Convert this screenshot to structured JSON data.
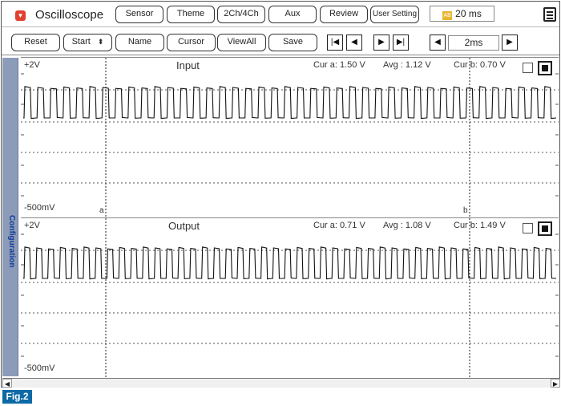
{
  "app": {
    "title": "Oscilloscope"
  },
  "toolbar_top": {
    "sensor": "Sensor",
    "theme": "Theme",
    "channels": "2Ch/4Ch",
    "aux": "Aux",
    "review": "Review",
    "user_setting": "User Setting",
    "time_display": "20 ms"
  },
  "toolbar_bottom": {
    "reset": "Reset",
    "start": "Start",
    "name": "Name",
    "cursor": "Cursor",
    "viewall": "ViewAll",
    "save": "Save",
    "time_div": "2ms"
  },
  "side_tab": {
    "label": "Configuration"
  },
  "channels": [
    {
      "title": "Input",
      "scale_top": "+2V",
      "scale_bottom": "-500mV",
      "cur_a": "Cur a: 1.50 V",
      "avg": "Avg  : 1.12 V",
      "cur_b": "Cur b: 0.70 V",
      "cursor_a_label": "a",
      "cursor_b_label": "b",
      "cycles": 41
    },
    {
      "title": "Output",
      "scale_top": "+2V",
      "scale_bottom": "-500mV",
      "cur_a": "Cur a: 0.71 V",
      "avg": "Avg  : 1.08 V",
      "cur_b": "Cur b: 1.49 V",
      "cycles": 45
    }
  ],
  "figure_label": "Fig.2"
}
